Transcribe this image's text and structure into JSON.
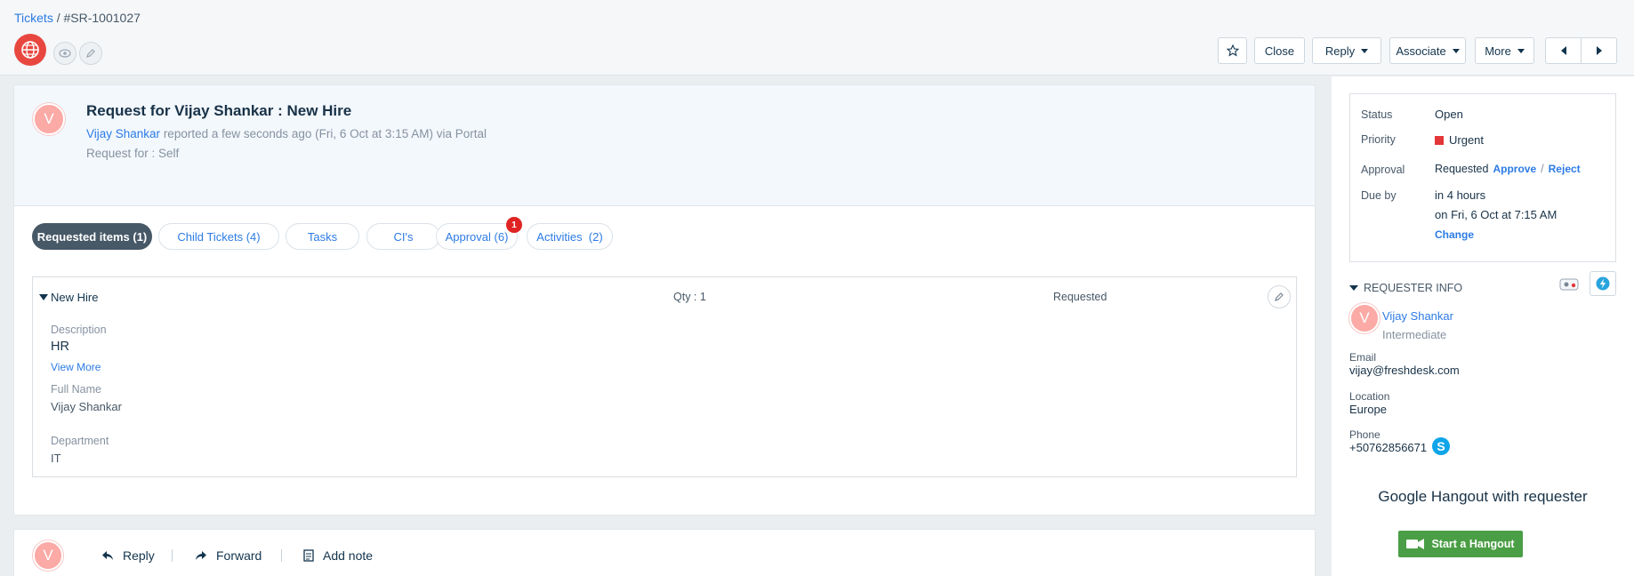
{
  "breadcrumb": {
    "parent": "Tickets",
    "separator": " / ",
    "ticket_id": "#SR-1001027"
  },
  "toolbar": {
    "close": "Close",
    "reply": "Reply",
    "associate": "Associate",
    "more": "More"
  },
  "ticket": {
    "avatar_letter": "V",
    "title": "Request for Vijay Shankar : New Hire",
    "requester": "Vijay Shankar",
    "reported": " reported a few seconds ago (Fri, 6 Oct at 3:15 AM) via Portal",
    "request_for": "Request for : Self"
  },
  "tabs": [
    {
      "label": "Requested items (1)"
    },
    {
      "label": "Child Tickets (4)"
    },
    {
      "label": "Tasks"
    },
    {
      "label": "CI's"
    },
    {
      "label": "Approval (6)"
    },
    {
      "label": "Activities  (2)"
    }
  ],
  "approval_badge": "1",
  "item": {
    "name": "New Hire",
    "qty": "Qty : 1",
    "status": "Requested",
    "description_label": "Description",
    "description": "HR",
    "view_more": "View More",
    "full_name_label": "Full Name",
    "full_name": "Vijay Shankar",
    "department_label": "Department",
    "department": "IT"
  },
  "reply_bar": {
    "reply": "Reply",
    "forward": "Forward",
    "add_note": "Add note"
  },
  "properties": {
    "status_label": "Status",
    "status": "Open",
    "priority_label": "Priority",
    "priority": "Urgent",
    "priority_color": "#e43538",
    "approval_label": "Approval",
    "approval": "Requested",
    "approve": "Approve",
    "slash": "/",
    "reject": "Reject",
    "due_label": "Due by",
    "due_rel": "in 4 hours",
    "due_abs": "on Fri, 6 Oct at 7:15 AM",
    "change": "Change"
  },
  "requester_info": {
    "header": "REQUESTER INFO",
    "avatar_letter": "V",
    "name": "Vijay Shankar",
    "level": "Intermediate",
    "email_label": "Email",
    "email": "vijay@freshdesk.com",
    "location_label": "Location",
    "location": "Europe",
    "phone_label": "Phone",
    "phone": "+50762856671"
  },
  "hangout": {
    "title": "Google Hangout with requester",
    "button": "Start a Hangout"
  }
}
